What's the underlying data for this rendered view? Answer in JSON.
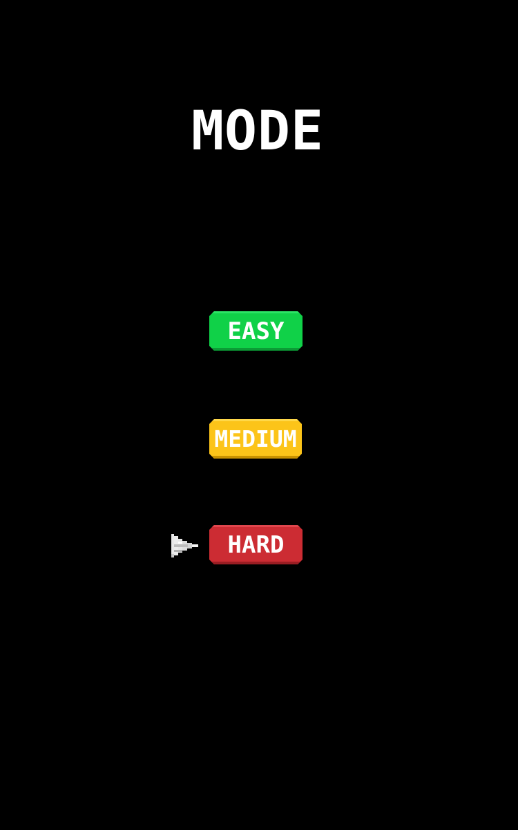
{
  "screen": {
    "title": "MODE",
    "background": "#000000"
  },
  "modes": [
    {
      "label": "EASY",
      "color": "#10d148",
      "selected": false
    },
    {
      "label": "MEDIUM",
      "color": "#fcc419",
      "selected": false
    },
    {
      "label": "HARD",
      "color": "#cc2c33",
      "selected": true
    }
  ],
  "cursor": {
    "icon": "spaceship-cursor-icon",
    "selected_mode": "HARD"
  }
}
